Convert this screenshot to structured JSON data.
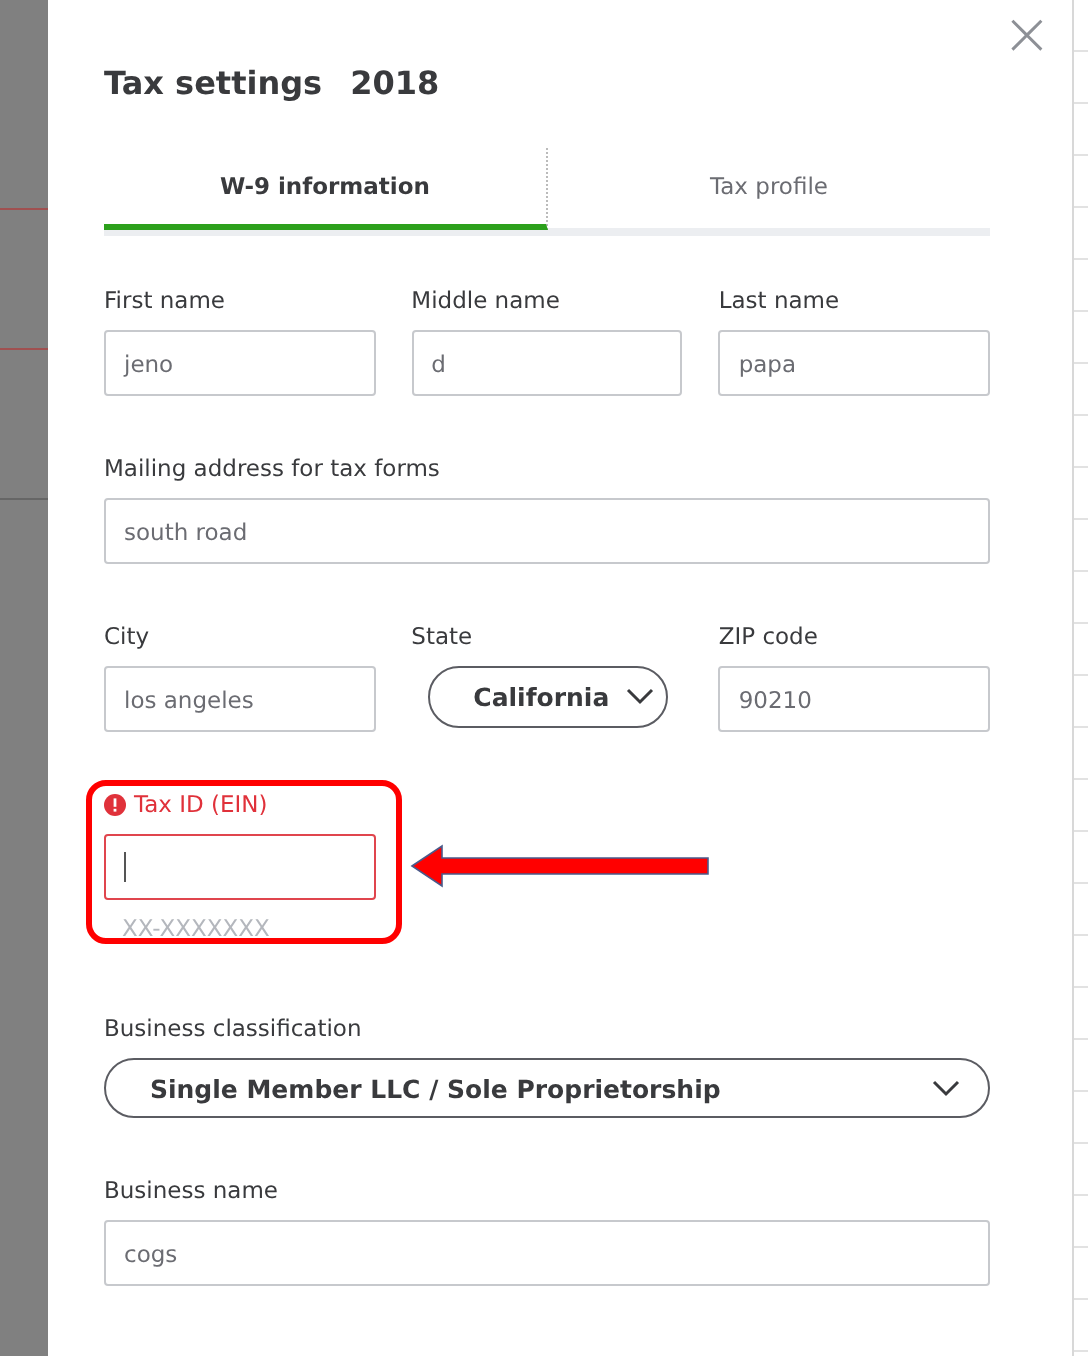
{
  "dialog": {
    "title": "Tax settings",
    "year": "2018",
    "close": "×"
  },
  "tabs": [
    {
      "label": "W-9 information",
      "selected": true
    },
    {
      "label": "Tax profile",
      "selected": false
    }
  ],
  "rows": [
    [
      {
        "kind": "text",
        "label": "First name",
        "value": "jeno"
      },
      {
        "kind": "text",
        "label": "Middle name",
        "value": "d"
      },
      {
        "kind": "text",
        "label": "Last name",
        "value": "papa"
      }
    ],
    [
      {
        "kind": "text",
        "label": "Mailing address for tax forms",
        "value": "south road"
      }
    ],
    [
      {
        "kind": "text",
        "label": "City",
        "value": "los angeles"
      },
      {
        "kind": "select",
        "label": "State",
        "value": "California"
      },
      {
        "kind": "text",
        "label": "ZIP code",
        "value": "90210"
      }
    ],
    [
      {
        "kind": "text",
        "label": "Tax ID (EIN)",
        "error": true,
        "focused": true,
        "hint": "XX-XXXXXXX",
        "highlighted": true
      }
    ],
    [
      {
        "kind": "select",
        "label": "Business classification",
        "value": "Single Member LLC / Sole Proprietorship"
      }
    ],
    [
      {
        "kind": "text",
        "label": "Business name",
        "value": "cogs"
      }
    ]
  ]
}
